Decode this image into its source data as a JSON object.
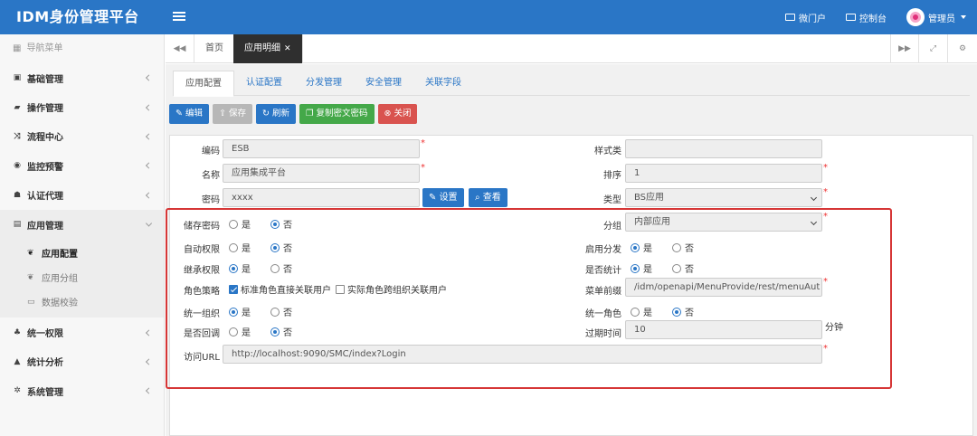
{
  "header": {
    "brand": "IDM身份管理平台",
    "nav": [
      {
        "label": "微门户",
        "icon": "id-card-icon"
      },
      {
        "label": "控制台",
        "icon": "monitor-icon"
      }
    ],
    "user_label": "管理员"
  },
  "sidebar": {
    "heading": "导航菜单",
    "items": [
      {
        "label": "基础管理",
        "icon": "id-card-icon"
      },
      {
        "label": "操作管理",
        "icon": "book-icon"
      },
      {
        "label": "流程中心",
        "icon": "shuffle-icon"
      },
      {
        "label": "监控预警",
        "icon": "eye-icon"
      },
      {
        "label": "认证代理",
        "icon": "users-icon"
      },
      {
        "label": "应用管理",
        "icon": "grid-icon"
      }
    ],
    "sub_items": [
      {
        "label": "应用配置",
        "icon": "leaf-icon"
      },
      {
        "label": "应用分组",
        "icon": "leaf-icon"
      },
      {
        "label": "数据校验",
        "icon": "folder-icon"
      }
    ],
    "items_after": [
      {
        "label": "统一权限",
        "icon": "sitemap-icon"
      },
      {
        "label": "统计分析",
        "icon": "area-chart-icon"
      },
      {
        "label": "系统管理",
        "icon": "cogs-icon"
      }
    ]
  },
  "tabstrip": {
    "tabs": [
      {
        "label": "首页"
      },
      {
        "label": "应用明细"
      }
    ],
    "close_glyph": "✕"
  },
  "inner_tabs": [
    "应用配置",
    "认证配置",
    "分发管理",
    "安全管理",
    "关联字段"
  ],
  "toolbar": {
    "edit": "编辑",
    "save": "保存",
    "refresh": "刷新",
    "copy": "复制密文密码",
    "close": "关闭"
  },
  "form": {
    "code_label": "编码",
    "code_value": "ESB",
    "name_label": "名称",
    "name_value": "应用集成平台",
    "pwd_label": "密码",
    "pwd_value": "xxxx",
    "set_btn": "设置",
    "view_btn": "查看",
    "style_label": "样式类",
    "style_value": "",
    "order_label": "排序",
    "order_value": "1",
    "type_label": "类型",
    "type_value": "BS应用",
    "store_pwd_label": "储存密码",
    "auto_perm_label": "自动权限",
    "inherit_perm_label": "继承权限",
    "role_policy_label": "角色策略",
    "role_direct": "标准角色直接关联用户",
    "role_cross": "实际角色跨组织关联用户",
    "unify_org_label": "统一组织",
    "callback_label": "是否回调",
    "group_label": "分组",
    "group_value": "内部应用",
    "dist_enable_label": "启用分发",
    "stat_label": "是否统计",
    "menu_prefix_label": "菜单前缀",
    "menu_prefix_value": "/idm/openapi/MenuProvide/rest/menuAut",
    "unify_role_label": "统一角色",
    "expire_label": "过期时间",
    "expire_value": "10",
    "expire_unit": "分钟",
    "url_label": "访问URL",
    "url_value": "http://localhost:9090/SMC/index?Login",
    "yes": "是",
    "no": "否",
    "required_mark": "*"
  },
  "colors": {
    "header_bg": "#2a76c6",
    "highlight_box": "#d63636",
    "btn_green": "#44a849",
    "btn_red": "#d9534f"
  }
}
